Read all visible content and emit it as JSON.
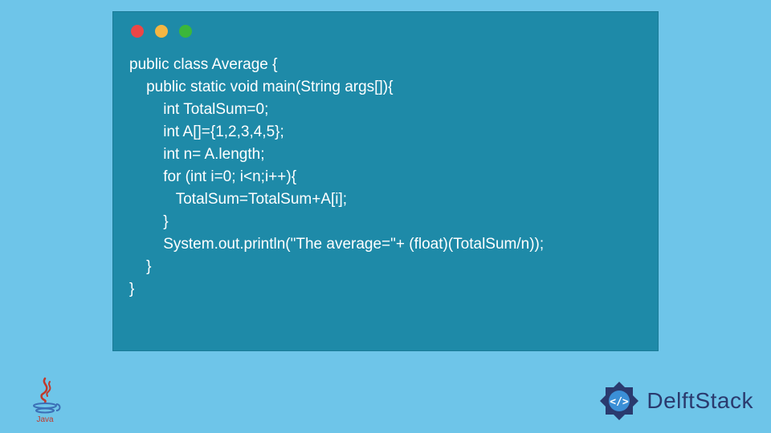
{
  "code": {
    "lines": [
      "public class Average {",
      "    public static void main(String args[]){",
      "        int TotalSum=0;",
      "        int A[]={1,2,3,4,5};",
      "        int n= A.length;",
      "        for (int i=0; i<n;i++){",
      "           TotalSum=TotalSum+A[i];",
      "        }",
      "        System.out.println(\"The average=\"+ (float)(TotalSum/n));",
      "    }",
      "}"
    ]
  },
  "brand": {
    "name": "DelftStack",
    "java_label": "Java"
  },
  "colors": {
    "bg": "#6ec5e9",
    "window": "#1e8aa8",
    "dot_red": "#ec4646",
    "dot_yellow": "#f5b642",
    "dot_green": "#3bb73b",
    "brand_text": "#2a3a6e",
    "java_red": "#c0392b",
    "java_blue": "#3b6fb6"
  }
}
